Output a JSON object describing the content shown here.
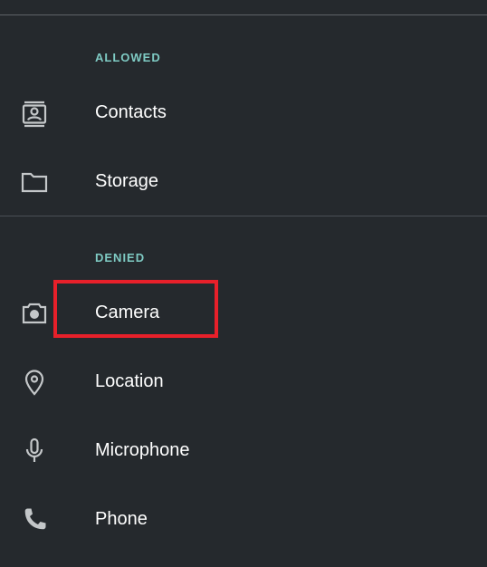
{
  "sections": {
    "allowed": {
      "header": "ALLOWED",
      "items": [
        {
          "label": "Contacts",
          "icon": "contacts-icon"
        },
        {
          "label": "Storage",
          "icon": "folder-icon"
        }
      ]
    },
    "denied": {
      "header": "DENIED",
      "items": [
        {
          "label": "Camera",
          "icon": "camera-icon"
        },
        {
          "label": "Location",
          "icon": "location-pin-icon"
        },
        {
          "label": "Microphone",
          "icon": "microphone-icon"
        },
        {
          "label": "Phone",
          "icon": "phone-icon"
        }
      ]
    }
  },
  "colors": {
    "background": "#25292d",
    "section_header": "#7fcbc4",
    "icon": "#c4c7c9",
    "highlight": "#e8202a"
  }
}
